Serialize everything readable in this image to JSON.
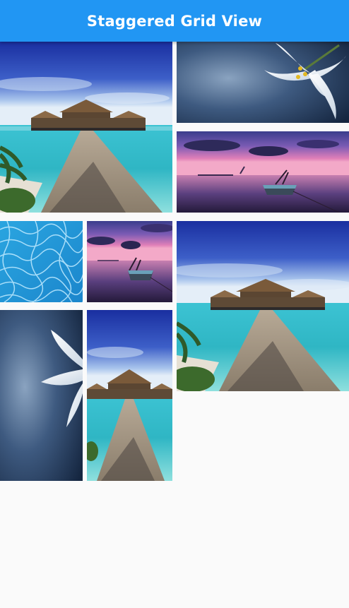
{
  "app_bar": {
    "title": "Staggered Grid View",
    "color": "#2196f3"
  },
  "grid": {
    "tiles": [
      {
        "image": "beach-pier-image"
      },
      {
        "image": "white-lily-flower-image"
      },
      {
        "image": "sunset-boat-lake-image"
      },
      {
        "image": "pool-water-texture-image"
      },
      {
        "image": "sunset-boat-lake-image"
      },
      {
        "image": "beach-pier-image"
      },
      {
        "image": "white-lily-flower-image"
      },
      {
        "image": "beach-pier-image"
      }
    ]
  }
}
